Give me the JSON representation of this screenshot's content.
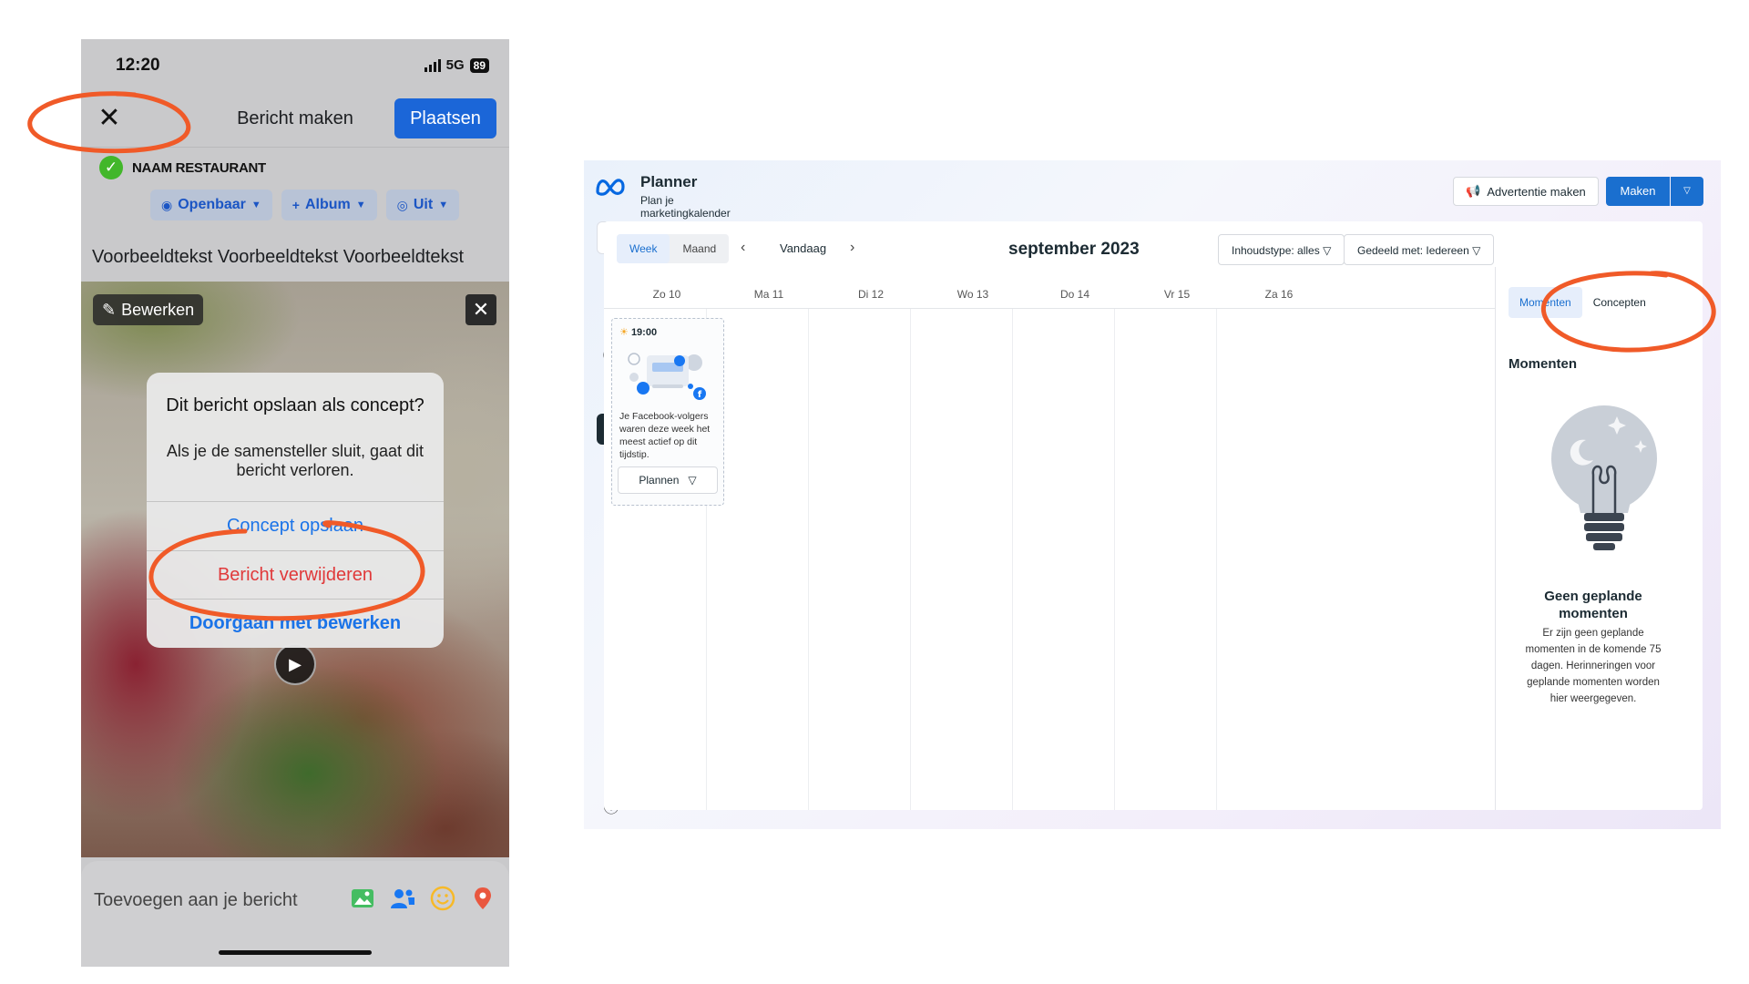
{
  "phone": {
    "status": {
      "time": "12:20",
      "network": "5G",
      "battery": "89"
    },
    "header": {
      "title": "Bericht maken",
      "post_label": "Plaatsen"
    },
    "page_name": "NAAM RESTAURANT",
    "audience": [
      {
        "label": "Openbaar",
        "icon": "globe-icon"
      },
      {
        "label": "Album",
        "icon": "plus-icon"
      },
      {
        "label": "Uit",
        "icon": "instagram-icon"
      }
    ],
    "post_text": "Voorbeeldtekst Voorbeeldtekst Voorbeeldtekst",
    "media": {
      "edit_label": "Bewerken"
    },
    "dialog": {
      "title": "Dit bericht opslaan als concept?",
      "message": "Als je de samensteller sluit, gaat dit bericht verloren.",
      "save_label": "Concept opslaan",
      "delete_label": "Bericht verwijderen",
      "continue_label": "Doorgaan met bewerken"
    },
    "bottom": {
      "label": "Toevoegen aan je bericht"
    },
    "colors": {
      "accent": "#1b66d8",
      "danger": "#e0393a",
      "annotation": "#f05a28"
    }
  },
  "desktop": {
    "title": "Planner",
    "subtitle": "Plan je marketingkalender door je inhoud te maken, te plannen en te beheren.",
    "ad_button": "Advertentie maken",
    "make_button": "Maken",
    "view_toggle": [
      "Week",
      "Maand"
    ],
    "today_label": "Vandaag",
    "month_label": "september 2023",
    "filters": {
      "content_type": "Inhoudstype: alles",
      "shared_with": "Gedeeld met: Iedereen"
    },
    "days": [
      "Zo 10",
      "Ma 11",
      "Di 12",
      "Wo 13",
      "Do 14",
      "Vr 15",
      "Za 16"
    ],
    "event": {
      "time": "19:00",
      "text": "Je Facebook-volgers waren deze week het meest actief op dit tijdstip.",
      "plan_label": "Plannen"
    },
    "side_tabs": [
      "Momenten",
      "Concepten"
    ],
    "side_title": "Momenten",
    "empty": {
      "title": "Geen geplande momenten",
      "text": "Er zijn geen geplande momenten in de komende 75 dagen. Herinneringen voor geplande momenten worden hier weergegeven."
    },
    "colors": {
      "primary": "#1a6fcf",
      "dark": "#1c2b33"
    }
  }
}
